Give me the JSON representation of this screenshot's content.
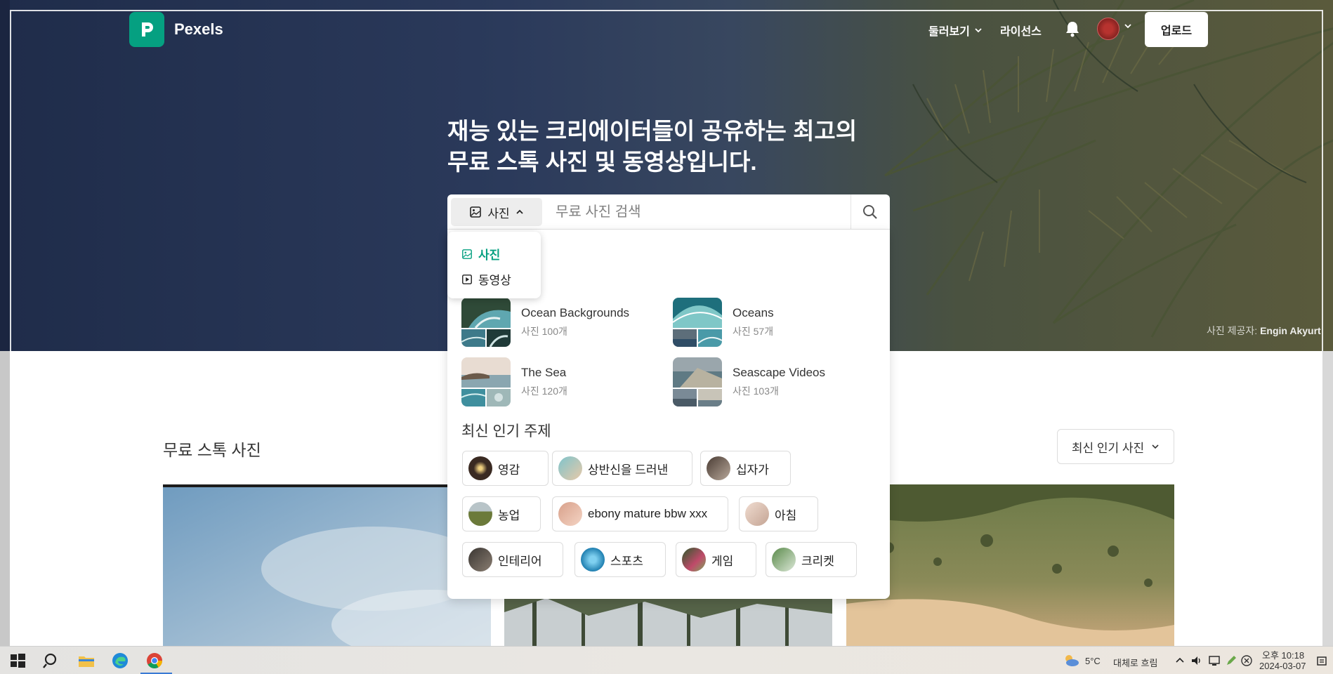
{
  "nav": {
    "brand": "Pexels",
    "explore": "둘러보기",
    "license": "라이선스",
    "upload": "업로드"
  },
  "hero": {
    "headline_line1": "재능 있는 크리에이터들이 공유하는 최고의",
    "headline_line2": "무료 스톡 사진 및 동영상입니다.",
    "credit_prefix": "사진 제공자:",
    "credit_name": "Engin Akyurt"
  },
  "search": {
    "type_label": "사진",
    "placeholder": "무료 사진 검색",
    "type_options": [
      {
        "label": "사진",
        "active": true
      },
      {
        "label": "동영상",
        "active": false
      }
    ]
  },
  "collections": [
    {
      "title": "Ocean Backgrounds",
      "count": "사진 100개"
    },
    {
      "title": "Oceans",
      "count": "사진 57개"
    },
    {
      "title": "The Sea",
      "count": "사진 120개"
    },
    {
      "title": "Seascape Videos",
      "count": "사진 103개"
    }
  ],
  "trending": {
    "title": "최신 인기 주제",
    "chips": [
      {
        "label": "영감",
        "color": "#3a2a22"
      },
      {
        "label": "상반신을 드러낸",
        "color": "#6fb0b8"
      },
      {
        "label": "십자가",
        "color": "#6a5a4e"
      },
      {
        "label": "농업",
        "color": "#7b8a4a"
      },
      {
        "label": "ebony mature bbw xxx",
        "color": "#c98a7a"
      },
      {
        "label": "아침",
        "color": "#e4c8b8"
      },
      {
        "label": "인테리어",
        "color": "#5a5550"
      },
      {
        "label": "스포츠",
        "color": "#2a8ac0"
      },
      {
        "label": "게임",
        "color": "#4a6a3a"
      },
      {
        "label": "크리켓",
        "color": "#8aa888"
      }
    ]
  },
  "main": {
    "section_title": "무료 스톡 사진",
    "sort_label": "최신 인기 사진"
  },
  "taskbar": {
    "weather_temp": "5°C",
    "weather_text": "대체로 흐림",
    "time": "오후 10:18",
    "date": "2024-03-07"
  },
  "colors": {
    "brand": "#05a081",
    "active_text": "#05a081"
  }
}
